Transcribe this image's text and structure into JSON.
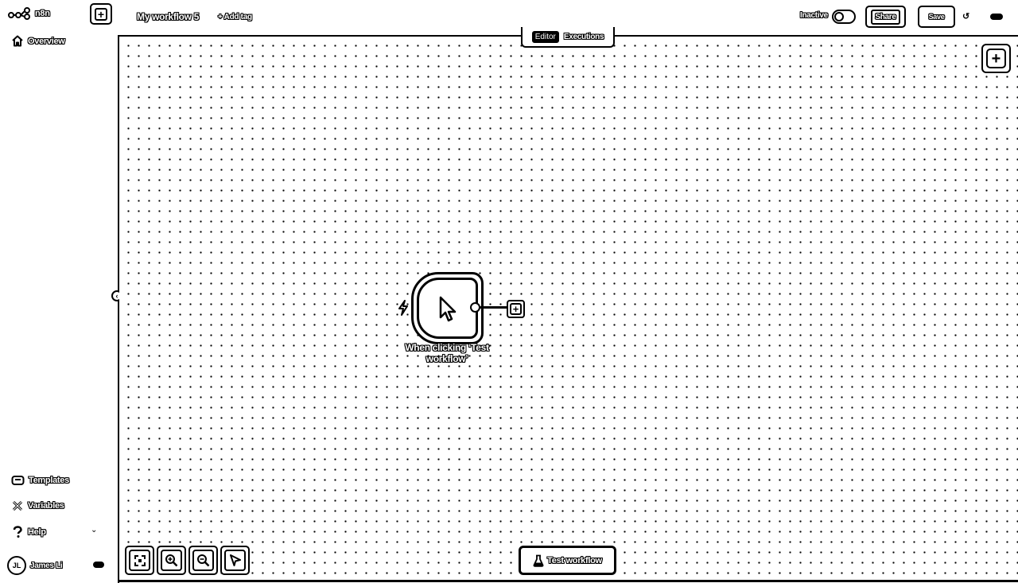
{
  "app": {
    "logo_text": "n8n",
    "new_button_label": "+"
  },
  "sidebar": {
    "items": [
      {
        "label": "Overview",
        "icon": "home-icon"
      },
      {
        "label": "Templates",
        "icon": "box-icon"
      },
      {
        "label": "Variables",
        "icon": "variables-icon"
      },
      {
        "label": "Help",
        "icon": "question-icon"
      }
    ],
    "collapse_glyph": "‹",
    "help_chevron": "⌄",
    "user": {
      "initials": "JL",
      "name": "James Li"
    }
  },
  "header": {
    "workflow_name": "My workflow 5",
    "add_tag": "+ Add tag",
    "tabs": [
      {
        "label": "Editor",
        "active": true
      },
      {
        "label": "Executions",
        "active": false
      }
    ],
    "status": "Inactive",
    "share_label": "Share",
    "save_label": "Save",
    "history_glyph": "↺"
  },
  "canvas": {
    "add_node_glyph": "+",
    "node": {
      "label": "When clicking ‘Test workflow’",
      "icon": "cursor-icon",
      "trigger_icon": "bolt-icon",
      "plus_glyph": "+"
    },
    "zoom_controls": [
      {
        "name": "zoom-to-fit-button",
        "icon": "fit-icon"
      },
      {
        "name": "zoom-in-button",
        "icon": "zoom-in-icon"
      },
      {
        "name": "zoom-out-button",
        "icon": "zoom-out-icon"
      },
      {
        "name": "tidy-up-button",
        "icon": "wand-icon"
      }
    ],
    "test_button_label": "Test workflow",
    "test_button_icon": "flask-icon"
  },
  "colors": {
    "ink": "#000000",
    "background": "#ffffff"
  }
}
